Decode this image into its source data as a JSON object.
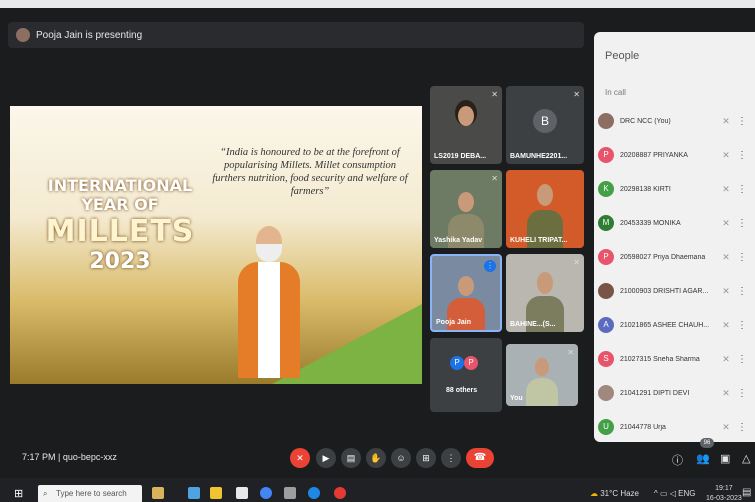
{
  "presenter_banner": "Pooja Jain is presenting",
  "slide": {
    "quote": "“India is honoured to be at the forefront of popularising Millets. Millet consumption furthers nutrition, food security and welfare of farmers”",
    "line1": "INTERNATIONAL YEAR OF",
    "line2": "MILLETS",
    "line3": "2023"
  },
  "tiles": [
    {
      "name": "LS2019 DEBA..."
    },
    {
      "name": "BAMUNHE2201...",
      "letter": "B"
    },
    {
      "name": "Yashika Yadav"
    },
    {
      "name": "KUHELI TRIPAT..."
    },
    {
      "name": "Pooja Jain"
    },
    {
      "name": "BAHINE...(S..."
    },
    {
      "name": "88 others",
      "letters": [
        "P",
        "P"
      ]
    },
    {
      "name": "You"
    }
  ],
  "people_panel": {
    "title": "People",
    "section": "In call",
    "participants": [
      {
        "name": "DRC NCC (You)",
        "avatar": "",
        "color": "#8d6e63"
      },
      {
        "name": "20208887 PRIYANKA",
        "avatar": "P",
        "color": "#e8546b"
      },
      {
        "name": "20298138 KIRTI",
        "avatar": "K",
        "color": "#43a047"
      },
      {
        "name": "20453339 MONIKA",
        "avatar": "M",
        "color": "#2e7d32"
      },
      {
        "name": "20598027 Priya Dhaemana",
        "avatar": "P",
        "color": "#e8546b"
      },
      {
        "name": "21000903 DRISHTI AGAR...",
        "avatar": "",
        "color": "#795548"
      },
      {
        "name": "21021865 ASHEE CHAUH...",
        "avatar": "A",
        "color": "#5c6bc0"
      },
      {
        "name": "21027315 Sneha Sharma",
        "avatar": "S",
        "color": "#e8546b"
      },
      {
        "name": "21041291 DIPTI DEVI",
        "avatar": "",
        "color": "#a1887f"
      },
      {
        "name": "21044778 Urja",
        "avatar": "U",
        "color": "#43a047"
      }
    ]
  },
  "meeting": {
    "time": "7:17 PM",
    "separator": "|",
    "code": "quo-bepc-xxz",
    "participant_count": "96"
  },
  "taskbar": {
    "search_placeholder": "Type here to search",
    "weather": "31°C Haze",
    "lang": "ENG",
    "time": "19:17",
    "date": "16-03-2023"
  }
}
